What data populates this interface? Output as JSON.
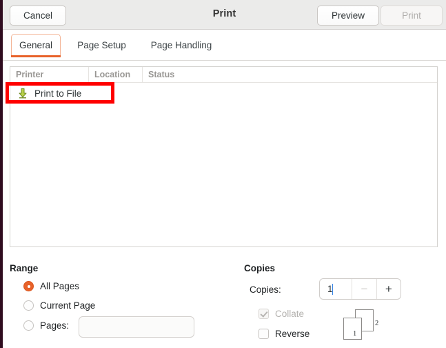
{
  "window": {
    "title": "Print"
  },
  "header": {
    "cancel_label": "Cancel",
    "title": "Print",
    "preview_label": "Preview",
    "print_label": "Print"
  },
  "tabs": [
    {
      "label": "General",
      "active": true
    },
    {
      "label": "Page Setup",
      "active": false
    },
    {
      "label": "Page Handling",
      "active": false
    }
  ],
  "printer_list": {
    "columns": [
      "Printer",
      "Location",
      "Status"
    ],
    "rows": [
      {
        "printer": "Print to File",
        "location": "",
        "status": "",
        "icon": "save-to-file-icon"
      }
    ]
  },
  "annotation": {
    "color": "#ff0000",
    "target": "Print to File"
  },
  "range": {
    "title": "Range",
    "options": [
      {
        "label": "All Pages",
        "selected": true
      },
      {
        "label": "Current Page",
        "selected": false
      },
      {
        "label": "Pages:",
        "selected": false
      }
    ],
    "pages_value": "",
    "pages_placeholder": ""
  },
  "copies": {
    "title": "Copies",
    "copies_label": "Copies:",
    "copies_value": "1",
    "decrement_label": "−",
    "increment_label": "+",
    "collate": {
      "label": "Collate",
      "checked": true,
      "enabled": false
    },
    "reverse": {
      "label": "Reverse",
      "checked": false,
      "enabled": true
    },
    "preview_pages": [
      "1",
      "2"
    ]
  },
  "colors": {
    "accent": "#e8622a",
    "header_bg": "#ebebea",
    "annotation": "#ff0000",
    "window_border": "#2f0c1f"
  }
}
